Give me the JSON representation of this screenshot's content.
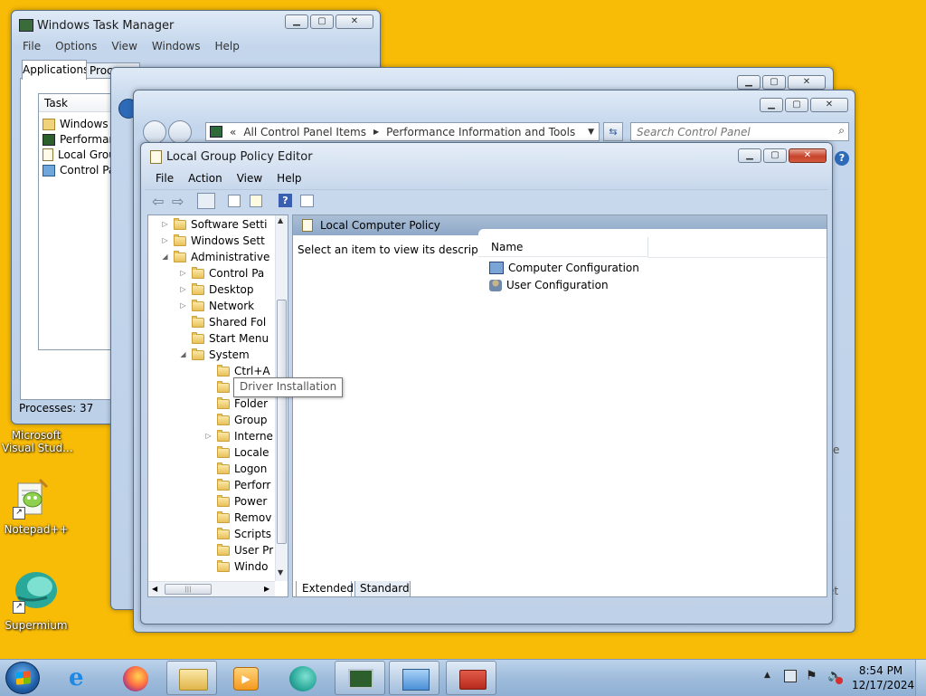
{
  "desktop": {
    "icons": [
      {
        "label": "Microsoft\nVisual Stud..."
      },
      {
        "label": "Notepad++"
      },
      {
        "label": "Supermium"
      }
    ]
  },
  "task_manager": {
    "title": "Windows Task Manager",
    "menu": [
      "File",
      "Options",
      "View",
      "Windows",
      "Help"
    ],
    "tabs": [
      "Applications",
      "Proce"
    ],
    "column_task": "Task",
    "tasks": [
      "Windows Ex",
      "Performance",
      "Local Group",
      "Control Pane"
    ],
    "status": "Processes: 37"
  },
  "control_panel": {
    "breadcrumb_prefix": "«",
    "breadcrumb_1": "All Control Panel Items",
    "breadcrumb_2": "Performance Information and Tools",
    "search_placeholder": "Search Control Panel",
    "frag_e": "e",
    "frag_t": "et"
  },
  "gpedit": {
    "title": "Local Group Policy Editor",
    "menu": [
      "File",
      "Action",
      "View",
      "Help"
    ],
    "tree": [
      {
        "label": "Software Setti",
        "indent": 0,
        "exp": "▷"
      },
      {
        "label": "Windows Sett",
        "indent": 0,
        "exp": "▷"
      },
      {
        "label": "Administrative",
        "indent": 0,
        "exp": "◢"
      },
      {
        "label": "Control Pa",
        "indent": 1,
        "exp": "▷"
      },
      {
        "label": "Desktop",
        "indent": 1,
        "exp": "▷"
      },
      {
        "label": "Network",
        "indent": 1,
        "exp": "▷"
      },
      {
        "label": "Shared Fol",
        "indent": 1,
        "exp": ""
      },
      {
        "label": "Start Menu",
        "indent": 1,
        "exp": ""
      },
      {
        "label": "System",
        "indent": 1,
        "exp": "◢"
      },
      {
        "label": "Ctrl+A",
        "indent": 2,
        "exp": ""
      },
      {
        "label": "",
        "indent": 2,
        "exp": ""
      },
      {
        "label": "Folder",
        "indent": 2,
        "exp": ""
      },
      {
        "label": "Group",
        "indent": 2,
        "exp": ""
      },
      {
        "label": "Interne",
        "indent": 2,
        "exp": "▷"
      },
      {
        "label": "Locale",
        "indent": 2,
        "exp": ""
      },
      {
        "label": "Logon",
        "indent": 2,
        "exp": ""
      },
      {
        "label": "Perforr",
        "indent": 2,
        "exp": ""
      },
      {
        "label": "Power",
        "indent": 2,
        "exp": ""
      },
      {
        "label": "Remov",
        "indent": 2,
        "exp": ""
      },
      {
        "label": "Scripts",
        "indent": 2,
        "exp": ""
      },
      {
        "label": "User Pr",
        "indent": 2,
        "exp": ""
      },
      {
        "label": "Windo",
        "indent": 2,
        "exp": ""
      }
    ],
    "tooltip": "Driver Installation",
    "header": "Local Computer Policy",
    "description": "Select an item to view its description.",
    "col_name": "Name",
    "items": [
      "Computer Configuration",
      "User Configuration"
    ],
    "tabs": [
      "Extended",
      "Standard"
    ]
  },
  "taskbar": {
    "time": "8:54 PM",
    "date": "12/17/2024"
  }
}
